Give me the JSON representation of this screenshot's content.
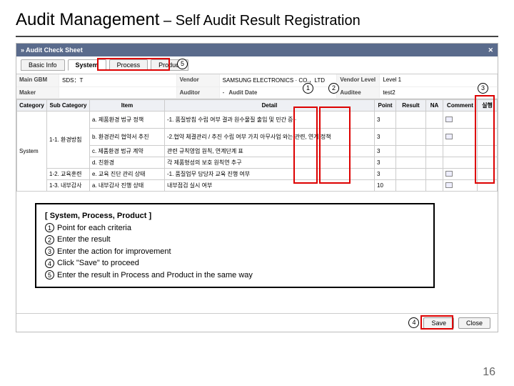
{
  "slide": {
    "title_main": "Audit Management",
    "title_sub": " – Self Audit Result Registration",
    "page_number": "16"
  },
  "header": {
    "title": "» Audit Check Sheet",
    "close_icon": "✕"
  },
  "tabs": {
    "basic": "Basic Info",
    "system": "System",
    "process": "Process",
    "product": "Product"
  },
  "info": {
    "main_gbm_label": "Main GBM",
    "main_gbm_value": "SDS：T",
    "vendor_label": "Vendor",
    "vendor_value": "SAMSUNG ELECTRONICS · CO.，LTD",
    "vendor_level_label": "Vendor Level",
    "vendor_level_value": "Level 1",
    "maker_label": "Maker",
    "maker_value": "",
    "auditor_label": "Auditor",
    "auditor_value": "-",
    "audit_date_label": "Audit Date",
    "audit_date_value": "",
    "auditee_label": "Auditee",
    "auditee_value": "test2"
  },
  "table": {
    "headers": {
      "category": "Category",
      "sub_category": "Sub Category",
      "item": "Item",
      "detail": "Detail",
      "point": "Point",
      "result": "Result",
      "na": "NA",
      "comment": "Comment",
      "action": "실행"
    },
    "rows": [
      {
        "category": "",
        "sub": "",
        "item": "a. 제품환경 법규 정책",
        "detail": "-1. 품질방침 수립 여부\n결과 원수물질 출입 및 민간 증 ·",
        "point": "3",
        "result": "",
        "na": "",
        "comment": "icon",
        "action": ""
      },
      {
        "category": "",
        "sub": "",
        "item": "b. 환경관리 협약서 추진",
        "detail": "-2.협약 체결관리 / 추진 수립 여부\n가치 아무사업 와는 관련, 연계 정책",
        "point": "3",
        "result": "",
        "na": "",
        "comment": "icon",
        "action": ""
      },
      {
        "category": "System",
        "sub": "1-1. 환경방침",
        "item": "c. 제품환경 법규 계약",
        "detail": "관련 규칙영업 원칙, 연계단계 표",
        "point": "3",
        "result": "",
        "na": "",
        "comment": "",
        "action": ""
      },
      {
        "category": "",
        "sub": "",
        "item": "d. 친환경",
        "detail": "각 제품형성의 보호 원칙연 추구",
        "point": "3",
        "result": "",
        "na": "",
        "comment": "",
        "action": ""
      },
      {
        "category": "",
        "sub": "1-2. 교육훈련",
        "item": "e. 교육 진단 관리 상태",
        "detail": "-1. 품질업무 담당자 교육 진행 여부",
        "point": "3",
        "result": "",
        "na": "",
        "comment": "icon",
        "action": ""
      },
      {
        "category": "",
        "sub": "1-3. 내부감사",
        "item": "a. 내부감사 진행 상태",
        "detail": "내부점검 실시 여부",
        "point": "10",
        "result": "",
        "na": "",
        "comment": "icon",
        "action": ""
      }
    ]
  },
  "instructions": {
    "header": "[ System, Process, Product ]",
    "lines": [
      "Point for each criteria",
      "Enter the result",
      "Enter the action for improvement",
      "Click \"Save\" to proceed",
      "Enter the result in Process and Product in the same way"
    ]
  },
  "callouts": {
    "c1": "1",
    "c2": "2",
    "c3": "3",
    "c4": "4",
    "c5": "5"
  },
  "buttons": {
    "save": "Save",
    "close": "Close"
  }
}
